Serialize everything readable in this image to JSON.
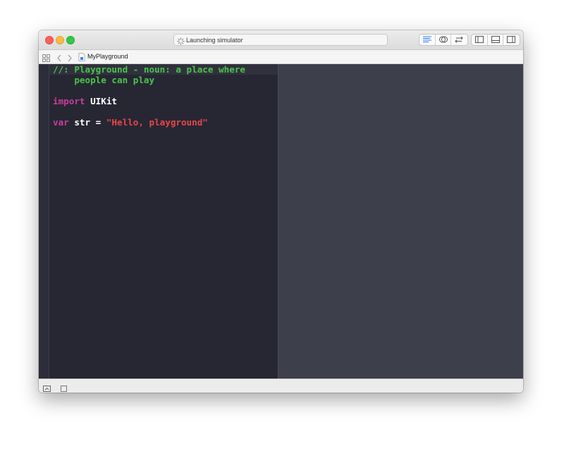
{
  "window": {
    "activity_status": "Launching simulator",
    "toolbar_icons": [
      "standard-editor-icon",
      "assistant-editor-icon",
      "version-editor-icon",
      "navigator-toggle-icon",
      "debug-area-toggle-icon",
      "utilities-toggle-icon"
    ]
  },
  "jumpbar": {
    "file_name": "MyPlayground",
    "icons": [
      "related-items-grid-icon",
      "back-arrow-icon",
      "forward-arrow-icon",
      "swift-file-icon"
    ]
  },
  "editor": {
    "lines": [
      {
        "tokens": [
          {
            "kind": "comment",
            "text": "//: Playground - noun: a place where"
          }
        ]
      },
      {
        "tokens": [
          {
            "kind": "comment",
            "text": "    people can play"
          }
        ]
      },
      {
        "tokens": []
      },
      {
        "tokens": [
          {
            "kind": "keyword",
            "text": "import"
          },
          {
            "kind": "plain",
            "text": " UIKit"
          }
        ]
      },
      {
        "tokens": []
      },
      {
        "tokens": [
          {
            "kind": "keyword",
            "text": "var"
          },
          {
            "kind": "plain",
            "text": " str = "
          },
          {
            "kind": "string",
            "text": "\"Hello, playground\""
          }
        ]
      }
    ]
  },
  "bottombar": {
    "icons": [
      "show-console-icon",
      "stop-execution-icon"
    ]
  },
  "colors": {
    "editor_background": "#262732",
    "results_background": "#3d3f4a",
    "comment": "#4bc44d",
    "keyword": "#c83d9c",
    "string": "#e8464a",
    "plain": "#ffffff"
  }
}
